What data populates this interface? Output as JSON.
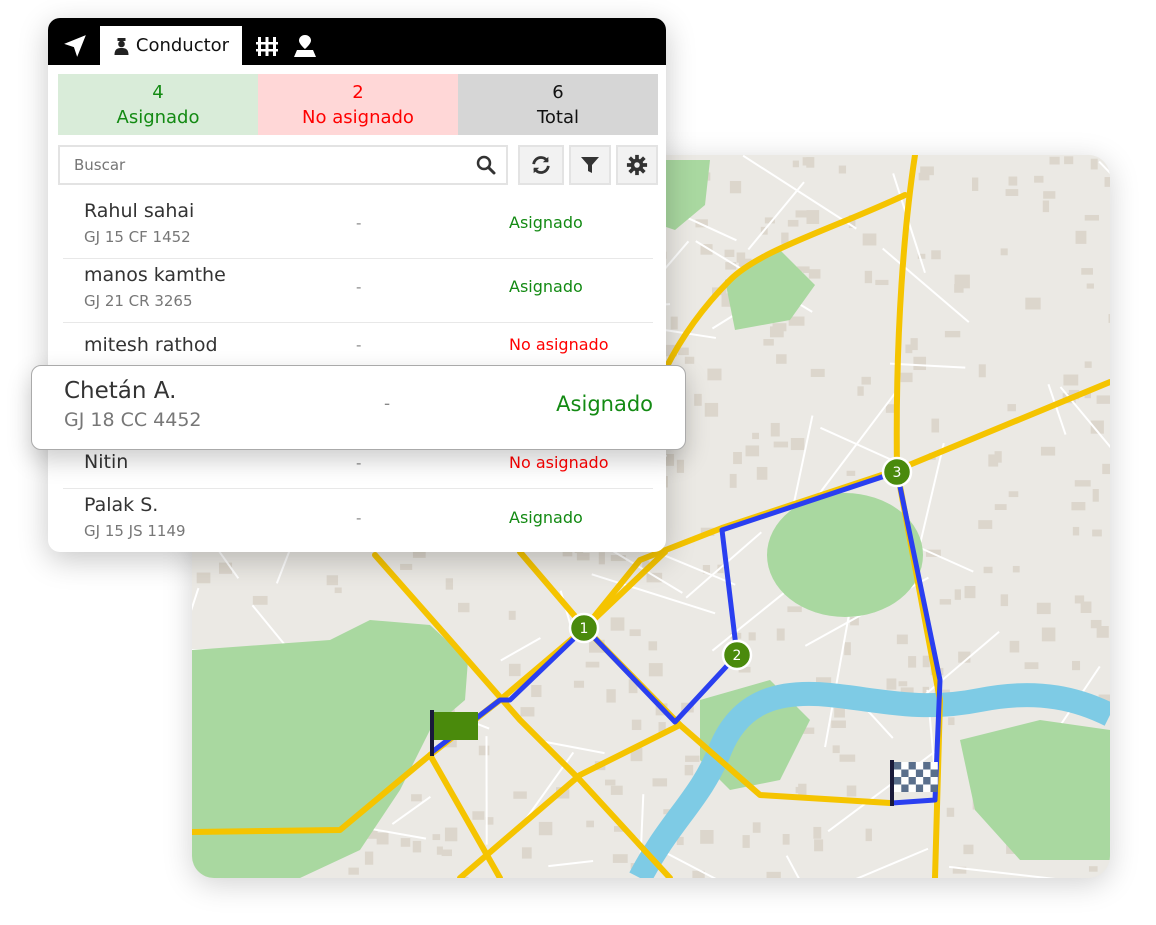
{
  "tabs": [
    {
      "icon": "navigation-arrow-icon",
      "label": ""
    },
    {
      "icon": "driver-icon",
      "label": "Conductor",
      "active": true
    },
    {
      "icon": "fence-icon",
      "label": ""
    },
    {
      "icon": "map-pin-area-icon",
      "label": ""
    }
  ],
  "stats": {
    "assigned": {
      "count": "4",
      "label": "Asignado",
      "color": "#138a13",
      "bg": "#d9ecd9"
    },
    "unassigned": {
      "count": "2",
      "label": "No asignado",
      "color": "#ff0000",
      "bg": "#ffd7d7"
    },
    "total": {
      "count": "6",
      "label": "Total",
      "color": "#111111",
      "bg": "#d6d6d6"
    }
  },
  "search": {
    "placeholder": "Buscar",
    "value": ""
  },
  "toolbar": {
    "refresh": "refresh-icon",
    "filter": "filter-icon",
    "settings": "gear-icon"
  },
  "drivers": [
    {
      "name": "Rahul sahai",
      "plate": "GJ 15 CF 1452",
      "vehicle": "-",
      "status": "Asignado"
    },
    {
      "name": "manos kamthe",
      "plate": "GJ 21 CR 3265",
      "vehicle": "-",
      "status": "Asignado"
    },
    {
      "name": "mitesh rathod",
      "plate": "",
      "vehicle": "-",
      "status": "No asignado"
    },
    {
      "name": "Nitin",
      "plate": "",
      "vehicle": "-",
      "status": "No asignado"
    },
    {
      "name": "Palak S.",
      "plate": "GJ 15 JS 1149",
      "vehicle": "-",
      "status": "Asignado"
    }
  ],
  "highlighted": {
    "name": "Chetán A.",
    "plate": "GJ 18 CC 4452",
    "vehicle": "-",
    "status": "Asignado"
  },
  "map": {
    "stops": [
      "1",
      "2",
      "3"
    ],
    "route_color": "#2a3ff0",
    "stop_color": "#4a8a0c",
    "road_color": "#f5c400",
    "park_color": "#a9d8a0",
    "water_color": "#7ecbe5",
    "start_icon": "start-flag-icon",
    "end_icon": "checkered-flag-icon"
  }
}
